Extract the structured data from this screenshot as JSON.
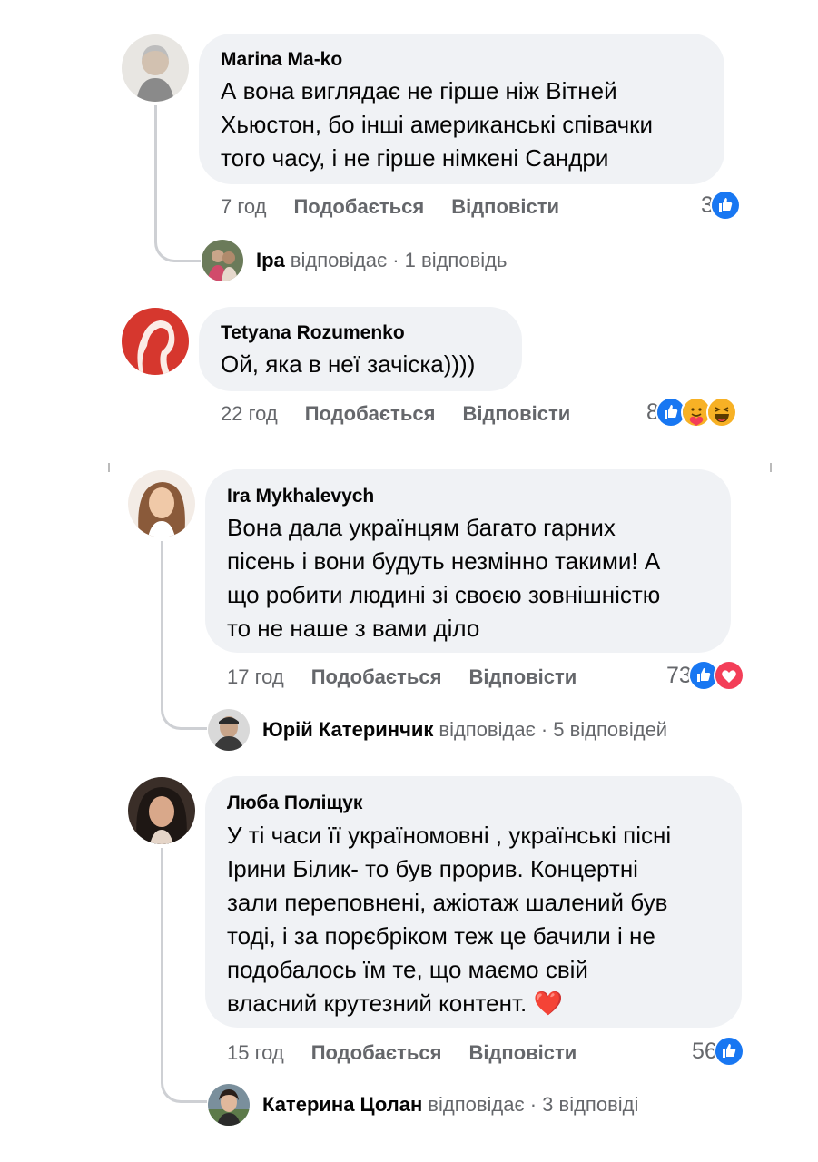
{
  "comments": [
    {
      "author": "Marina Ma-ko",
      "text": "А вона виглядає не гірше ніж Вітней\nХьюстон, бо інші американські співачки\nтого часу, і не гірше німкені Сандри",
      "time": "7 год",
      "like": "Подобається",
      "reply": "Відповісти",
      "reactions_count": "3",
      "reactions": [
        "like"
      ],
      "reply_summary": {
        "name": "Іра",
        "verb": "відповідає",
        "count": "· 1 відповідь"
      }
    },
    {
      "author": "Tetyana Rozumenko",
      "text": "Ой, яка в неї зачіска))))",
      "time": "22 год",
      "like": "Подобається",
      "reply": "Відповісти",
      "reactions_count": "8",
      "reactions": [
        "like",
        "care",
        "haha"
      ]
    },
    {
      "author": "Ira Mykhalevych",
      "text": "Вона дала українцям багато гарних\nпісень і вони будуть незмінно такими! А\nщо робити людині зі своєю зовнішністю\nто не наше з вами діло",
      "time": "17 год",
      "like": "Подобається",
      "reply": "Відповісти",
      "reactions_count": "73",
      "reactions": [
        "like",
        "love"
      ],
      "reply_summary": {
        "name": "Юрій Катеринчик",
        "verb": "відповідає",
        "count": "· 5 відповідей"
      }
    },
    {
      "author": "Люба Поліщук",
      "text": "У ті часи її україномовні , українські пісні\nІрини Білик- то був прорив. Концертні\nзали переповнені, ажіотаж шалений був\nтоді, і за порєбріком теж це бачили і не\nподобалось їм те, що маємо свій\nвласний крутезний контент. ❤️",
      "time": "15 год",
      "like": "Подобається",
      "reply": "Відповісти",
      "reactions_count": "56",
      "reactions": [
        "like"
      ],
      "reply_summary": {
        "name": "Катерина Цолан",
        "verb": "відповідає",
        "count": "· 3 відповіді"
      }
    }
  ],
  "colors": {
    "like": "#1877f2",
    "love": "#f33e58",
    "bubble": "#f0f2f5",
    "meta": "#65676b"
  }
}
